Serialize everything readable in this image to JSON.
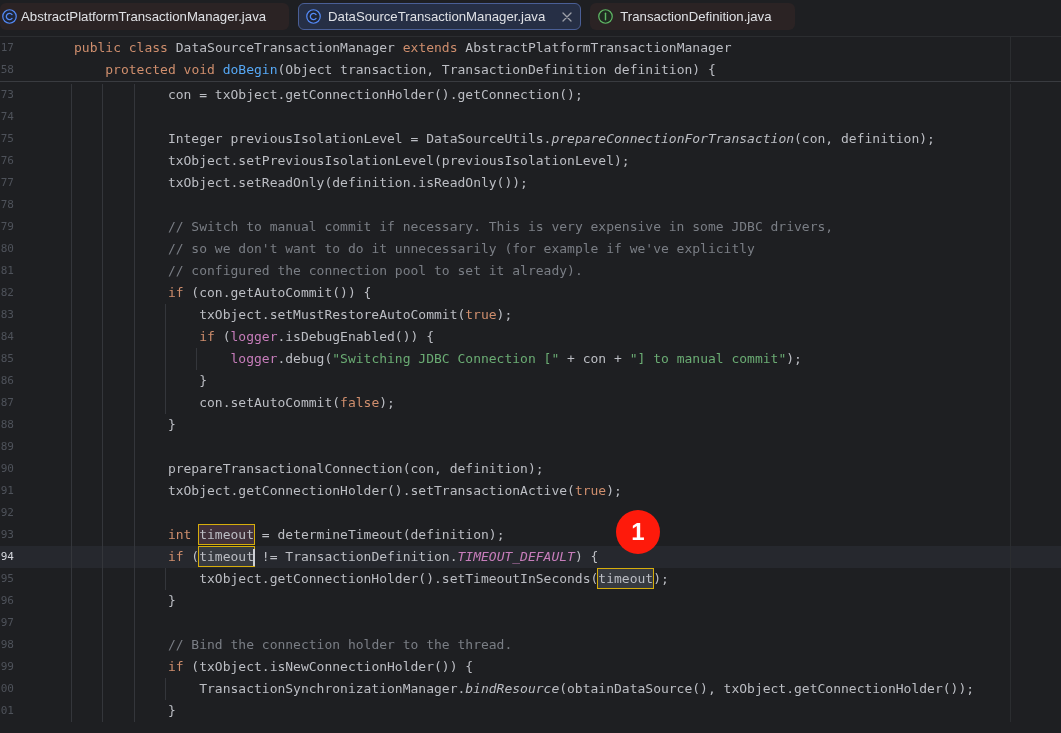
{
  "tabs": [
    {
      "label": "AbstractPlatformTransactionManager.java",
      "kind": "class",
      "selected": false,
      "closable": false
    },
    {
      "label": "DataSourceTransactionManager.java",
      "kind": "class",
      "selected": true,
      "closable": true
    },
    {
      "label": "TransactionDefinition.java",
      "kind": "interface",
      "selected": false,
      "closable": false
    }
  ],
  "editor": {
    "sticky_lines": [
      {
        "number": "17",
        "tokens": [
          {
            "kind": "keyword",
            "text": "public class"
          },
          {
            "kind": "plain",
            "text": " DataSourceTransactionManager "
          },
          {
            "kind": "keyword",
            "text": "extends"
          },
          {
            "kind": "plain",
            "text": " AbstractPlatformTransactionManager"
          }
        ]
      },
      {
        "number": "58",
        "tokens": [
          {
            "kind": "keyword",
            "text": "    protected void "
          },
          {
            "kind": "method_declaration",
            "text": "doBegin"
          },
          {
            "kind": "plain",
            "text": "(Object transaction, TransactionDefinition definition) {"
          }
        ]
      }
    ],
    "lines": [
      {
        "number": "73",
        "current": false,
        "tokens": [
          {
            "kind": "plain",
            "text": "            con = txObject.getConnectionHolder().getConnection();"
          }
        ]
      },
      {
        "number": "74",
        "current": false
      },
      {
        "number": "75",
        "current": false,
        "tokens": [
          {
            "kind": "plain",
            "text": "            Integer previousIsolationLevel = DataSourceUtils."
          },
          {
            "kind": "static_call",
            "text": "prepareConnectionForTransaction"
          },
          {
            "kind": "plain",
            "text": "(con, definition);"
          }
        ]
      },
      {
        "number": "76",
        "current": false,
        "tokens": [
          {
            "kind": "plain",
            "text": "            txObject.setPreviousIsolationLevel(previousIsolationLevel);"
          }
        ]
      },
      {
        "number": "77",
        "current": false,
        "tokens": [
          {
            "kind": "plain",
            "text": "            txObject.setReadOnly(definition.isReadOnly());"
          }
        ]
      },
      {
        "number": "78",
        "current": false
      },
      {
        "number": "79",
        "current": false,
        "tokens": [
          {
            "kind": "comment",
            "text": "            // Switch to manual commit if necessary. This is very expensive in some JDBC drivers,"
          }
        ]
      },
      {
        "number": "80",
        "current": false,
        "tokens": [
          {
            "kind": "comment",
            "text": "            // so we don't want to do it unnecessarily (for example if we've explicitly"
          }
        ]
      },
      {
        "number": "81",
        "current": false,
        "tokens": [
          {
            "kind": "comment",
            "text": "            // configured the connection pool to set it already)."
          }
        ]
      },
      {
        "number": "82",
        "current": false,
        "tokens": [
          {
            "kind": "keyword",
            "text": "            if"
          },
          {
            "kind": "plain",
            "text": " (con.getAutoCommit()) {"
          }
        ]
      },
      {
        "number": "83",
        "current": false,
        "tokens": [
          {
            "kind": "plain",
            "text": "                txObject.setMustRestoreAutoCommit("
          },
          {
            "kind": "keyword",
            "text": "true"
          },
          {
            "kind": "plain",
            "text": ");"
          }
        ]
      },
      {
        "number": "84",
        "current": false,
        "tokens": [
          {
            "kind": "keyword",
            "text": "                if"
          },
          {
            "kind": "plain",
            "text": " ("
          },
          {
            "kind": "field",
            "text": "logger"
          },
          {
            "kind": "plain",
            "text": ".isDebugEnabled()) {"
          }
        ]
      },
      {
        "number": "85",
        "current": false,
        "tokens": [
          {
            "kind": "field",
            "text": "                    logger"
          },
          {
            "kind": "plain",
            "text": ".debug("
          },
          {
            "kind": "string",
            "text": "\"Switching JDBC Connection [\""
          },
          {
            "kind": "plain",
            "text": " + con + "
          },
          {
            "kind": "string",
            "text": "\"] to manual commit\""
          },
          {
            "kind": "plain",
            "text": ");"
          }
        ]
      },
      {
        "number": "86",
        "current": false,
        "tokens": [
          {
            "kind": "plain",
            "text": "                }"
          }
        ]
      },
      {
        "number": "87",
        "current": false,
        "tokens": [
          {
            "kind": "plain",
            "text": "                con.setAutoCommit("
          },
          {
            "kind": "keyword",
            "text": "false"
          },
          {
            "kind": "plain",
            "text": ");"
          }
        ]
      },
      {
        "number": "88",
        "current": false,
        "tokens": [
          {
            "kind": "plain",
            "text": "            }"
          }
        ]
      },
      {
        "number": "89",
        "current": false
      },
      {
        "number": "90",
        "current": false,
        "tokens": [
          {
            "kind": "plain",
            "text": "            prepareTransactionalConnection(con, definition);"
          }
        ]
      },
      {
        "number": "91",
        "current": false,
        "tokens": [
          {
            "kind": "plain",
            "text": "            txObject.getConnectionHolder().setTransactionActive("
          },
          {
            "kind": "keyword",
            "text": "true"
          },
          {
            "kind": "plain",
            "text": ");"
          }
        ]
      },
      {
        "number": "92",
        "current": false
      },
      {
        "number": "93",
        "current": false,
        "tokens": [
          {
            "kind": "keyword",
            "text": "            int "
          },
          {
            "kind": "write_usage",
            "text": "timeout"
          },
          {
            "kind": "plain",
            "text": " = determineTimeout(definition);"
          }
        ]
      },
      {
        "number": "94",
        "current": true,
        "tokens": [
          {
            "kind": "keyword",
            "text": "            if"
          },
          {
            "kind": "plain",
            "text": " ("
          },
          {
            "kind": "read_usage",
            "text": "timeout"
          },
          {
            "kind": "caret"
          },
          {
            "kind": "plain",
            "text": " != TransactionDefinition."
          },
          {
            "kind": "constant",
            "text": "TIMEOUT_DEFAULT"
          },
          {
            "kind": "plain",
            "text": ") {"
          }
        ]
      },
      {
        "number": "95",
        "current": false,
        "tokens": [
          {
            "kind": "plain",
            "text": "                txObject.getConnectionHolder().setTimeoutInSeconds("
          },
          {
            "kind": "read_usage",
            "text": "timeout"
          },
          {
            "kind": "plain",
            "text": ");"
          }
        ]
      },
      {
        "number": "96",
        "current": false,
        "tokens": [
          {
            "kind": "plain",
            "text": "            }"
          }
        ]
      },
      {
        "number": "97",
        "current": false
      },
      {
        "number": "98",
        "current": false,
        "tokens": [
          {
            "kind": "comment",
            "text": "            // Bind the connection holder to the thread."
          }
        ]
      },
      {
        "number": "99",
        "current": false,
        "tokens": [
          {
            "kind": "keyword",
            "text": "            if"
          },
          {
            "kind": "plain",
            "text": " (txObject.isNewConnectionHolder()) {"
          }
        ]
      },
      {
        "number": "00",
        "current": false,
        "tokens": [
          {
            "kind": "plain",
            "text": "                TransactionSynchronizationManager."
          },
          {
            "kind": "static_call",
            "text": "bindResource"
          },
          {
            "kind": "plain",
            "text": "(obtainDataSource(), txObject.getConnectionHolder());"
          }
        ]
      },
      {
        "number": "01",
        "current": false,
        "tokens": [
          {
            "kind": "plain",
            "text": "            }"
          }
        ]
      }
    ],
    "callout": {
      "label": "1"
    }
  }
}
